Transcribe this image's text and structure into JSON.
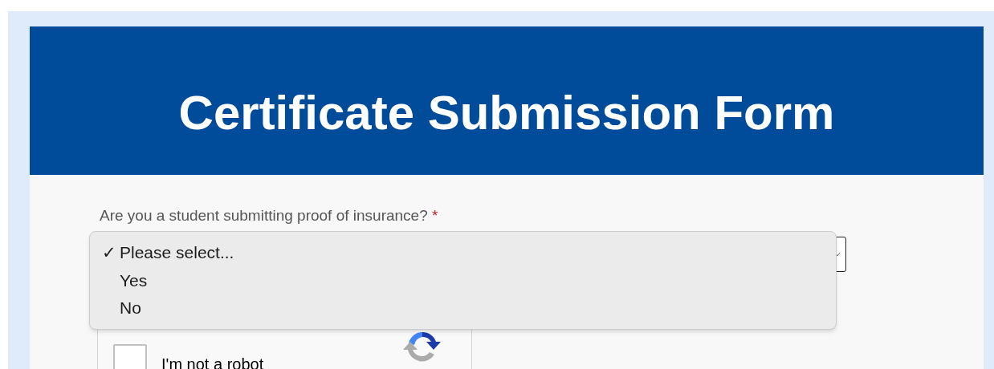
{
  "header": {
    "title": "Certificate Submission Form"
  },
  "question": {
    "label": "Are you a student submitting proof of insurance?",
    "required_mark": "*",
    "expanded": true,
    "check_mark": "✓",
    "options": [
      {
        "label": "Please select...",
        "selected": true
      },
      {
        "label": "Yes",
        "selected": false
      },
      {
        "label": "No",
        "selected": false
      }
    ]
  },
  "captcha": {
    "label": "I'm not a robot",
    "checked": false
  }
}
